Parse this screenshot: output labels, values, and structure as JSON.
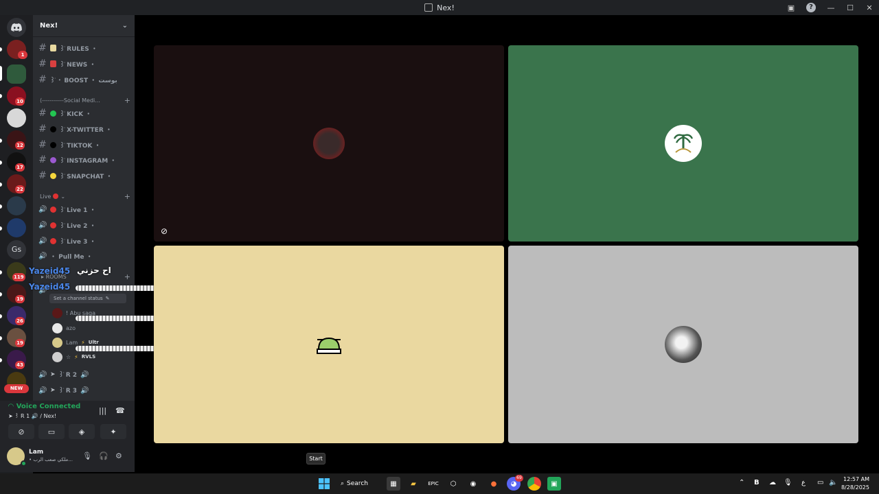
{
  "window": {
    "title": "Nex!"
  },
  "server": {
    "name": "Nex!"
  },
  "colors": {
    "rail_bg": "#1e1f22",
    "sidebar_bg": "#2b2d31",
    "accent_green": "#23a55a",
    "badge_red": "#da373c",
    "tile_dark": "#1a0f10",
    "tile_green": "#3a744c",
    "tile_sand": "#ead8a0",
    "tile_grey": "#bcbcbc"
  },
  "rail": {
    "badges": [
      "1",
      "10",
      "12",
      "17",
      "22",
      "119",
      "19",
      "26",
      "19",
      "43"
    ],
    "gs_label": "Gs",
    "new_label": "NEW"
  },
  "channels": {
    "top": [
      {
        "label": "ׁ꒱ RULES ・"
      },
      {
        "label": "ׁ꒱ NEWS ・"
      },
      {
        "label": "ׁ꒱ ・ BOOST ・ بوست"
      }
    ],
    "social_category": "⟨-----------Social Medi...",
    "social": [
      {
        "label": "ׁ꒱ KICK ・",
        "dot": "#23c552"
      },
      {
        "label": "ׁ꒱ X-TWITTER ・",
        "dot": "#000000"
      },
      {
        "label": "ׁ꒱ TIKTOK ・",
        "dot": "#000000"
      },
      {
        "label": "ׁ꒱ INSTAGRAM ・",
        "dot": "#9b59d0"
      },
      {
        "label": "ׁ꒱ SNAPCHAT ・",
        "dot": "#f5d63d"
      }
    ],
    "live_category": "Live",
    "live": [
      {
        "label": "ׁ꒱ Live 1 ・"
      },
      {
        "label": "ׁ꒱ Live 2 ・"
      },
      {
        "label": "ׁ꒱ Live 3 ・"
      }
    ],
    "pull_me": "・ Pull Me ・",
    "rooms_category": "ROOMS",
    "status_placeholder": "Set a channel status",
    "members": [
      {
        "name": "! Abu saqa"
      },
      {
        "name": "azo"
      },
      {
        "name": "Lam",
        "tag": "Ultr"
      },
      {
        "name": "☆",
        "tag": "RVLS"
      }
    ],
    "rooms": [
      {
        "label": "ׁ꒱ R 2"
      },
      {
        "label": "ׁ꒱ R 3"
      }
    ]
  },
  "overlay": {
    "name1": "Yazeid45",
    "name2": "Yazeid45",
    "arabic": "اح حزني"
  },
  "voice": {
    "title": "Voice Connected",
    "sub": "➤ ׁ꒱ R 1 🔊 / Nex!"
  },
  "user": {
    "name": "Lam",
    "status": "• ملكي صعب الرب..."
  },
  "tooltip": "Start",
  "taskbar": {
    "search_label": "Search",
    "discord_badge": "69",
    "time": "12:57 AM",
    "date": "8/28/2025",
    "lang": "ع"
  }
}
